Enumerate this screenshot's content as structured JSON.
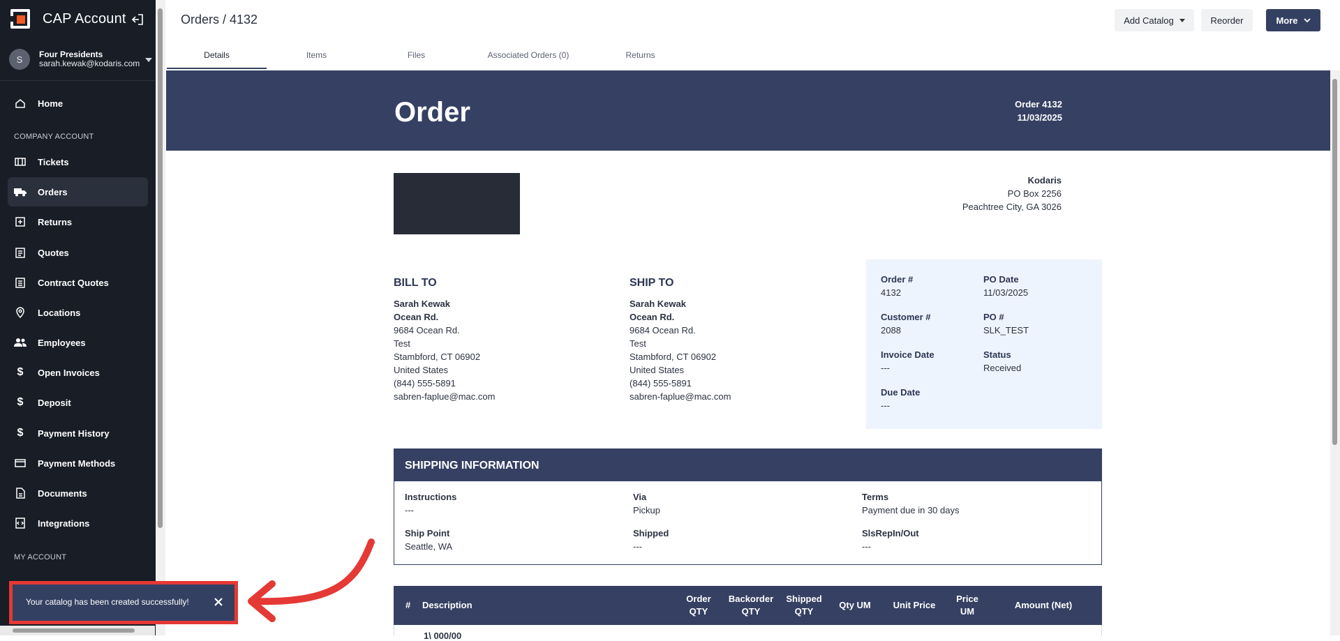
{
  "app": {
    "title": "CAP Account",
    "brand_color": "#f15a22"
  },
  "user": {
    "initial": "S",
    "name": "Four Presidents",
    "email": "sarah.kewak@kodaris.com"
  },
  "nav": {
    "home": "Home",
    "section_company": "COMPANY ACCOUNT",
    "tickets": "Tickets",
    "orders": "Orders",
    "returns": "Returns",
    "quotes": "Quotes",
    "contract_quotes": "Contract Quotes",
    "locations": "Locations",
    "employees": "Employees",
    "open_invoices": "Open Invoices",
    "deposit": "Deposit",
    "payment_history": "Payment History",
    "payment_methods": "Payment Methods",
    "documents": "Documents",
    "integrations": "Integrations",
    "section_my": "MY ACCOUNT"
  },
  "toast": {
    "message": "Your catalog has been created successfully!"
  },
  "header": {
    "breadcrumb": "Orders / 4132",
    "add_catalog": "Add Catalog",
    "reorder": "Reorder",
    "more": "More"
  },
  "tabs": [
    "Details",
    "Items",
    "Files",
    "Associated Orders (0)",
    "Returns"
  ],
  "order": {
    "title": "Order",
    "number_label": "Order 4132",
    "date": "11/03/2025",
    "company": {
      "name": "Kodaris",
      "line1": "PO Box 2256",
      "line2": "Peachtree City, GA 3026"
    },
    "bill_to": {
      "heading": "BILL TO",
      "name": "Sarah Kewak",
      "company": "Ocean Rd.",
      "street": "9684 Ocean Rd.",
      "line2": "Test",
      "city": "Stambford, CT 06902",
      "country": "United States",
      "phone": "(844) 555-5891",
      "email": "sabren-faplue@mac.com"
    },
    "ship_to": {
      "heading": "SHIP TO",
      "name": "Sarah Kewak",
      "company": "Ocean Rd.",
      "street": "9684 Ocean Rd.",
      "line2": "Test",
      "city": "Stambford, CT 06902",
      "country": "United States",
      "phone": "(844) 555-5891",
      "email": "sabren-faplue@mac.com"
    },
    "info": {
      "order_no_label": "Order #",
      "order_no": "4132",
      "po_date_label": "PO Date",
      "po_date": "11/03/2025",
      "customer_label": "Customer #",
      "customer": "2088",
      "po_label": "PO #",
      "po": "SLK_TEST",
      "invoice_date_label": "Invoice Date",
      "invoice_date": "---",
      "status_label": "Status",
      "status": "Received",
      "due_date_label": "Due Date",
      "due_date": "---"
    },
    "shipping": {
      "heading": "SHIPPING INFORMATION",
      "instructions_label": "Instructions",
      "instructions": "---",
      "via_label": "Via",
      "via": "Pickup",
      "terms_label": "Terms",
      "terms": "Payment due in 30 days",
      "ship_point_label": "Ship Point",
      "ship_point": "Seattle, WA",
      "shipped_label": "Shipped",
      "shipped": "---",
      "slsrep_label": "SlsRepIn/Out",
      "slsrep": "---"
    },
    "items": {
      "col_num": "#",
      "col_desc": "Description",
      "col_order_qty": "Order QTY",
      "col_backorder": "Backorder QTY",
      "col_shipped": "Shipped QTY",
      "col_qty_um": "Qty UM",
      "col_unit_price": "Unit Price",
      "col_price_um": "Price UM",
      "col_amount": "Amount (Net)",
      "first_row_partial": "1\\ 000/00"
    }
  }
}
